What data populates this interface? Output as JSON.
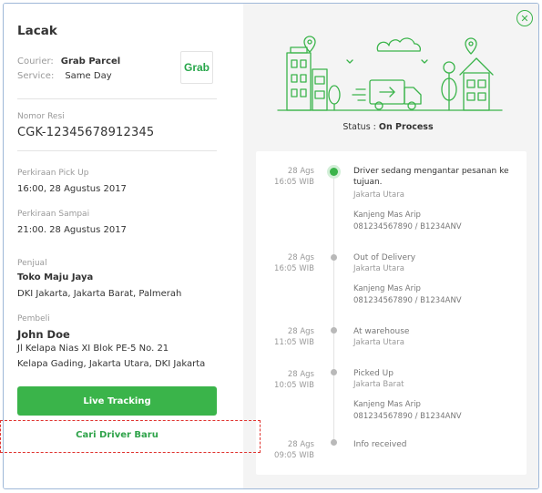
{
  "title": "Lacak",
  "courier": {
    "label": "Courier:",
    "value": "Grab Parcel"
  },
  "service": {
    "label": "Service:",
    "value": "Same Day"
  },
  "logo_text": "Grab",
  "resi": {
    "label": "Nomor Resi",
    "value": "CGK-12345678912345"
  },
  "pickup": {
    "label": "Perkiraan Pick Up",
    "value": "16:00, 28 Agustus 2017"
  },
  "arrival": {
    "label": "Perkiraan Sampai",
    "value": "21:00. 28 Agustus 2017"
  },
  "seller": {
    "label": "Penjual",
    "name": "Toko Maju Jaya",
    "address": "DKI Jakarta, Jakarta Barat, Palmerah"
  },
  "buyer": {
    "label": "Pembeli",
    "name": "John Doe",
    "address1": "Jl Kelapa Nias XI Blok PE-5 No. 21",
    "address2": "Kelapa Gading, Jakarta Utara, DKI Jakarta"
  },
  "buttons": {
    "live_tracking": "Live Tracking",
    "new_driver": "Cari Driver Baru"
  },
  "status": {
    "label": "Status :",
    "value": "On Process"
  },
  "timeline": [
    {
      "date": "28 Ags",
      "time": "16:05 WIB",
      "title": "Driver sedang mengantar pesanan ke tujuan.",
      "location": "Jakarta Utara",
      "driver_name": "Kanjeng Mas Arip",
      "driver_info": "081234567890 / B1234ANV"
    },
    {
      "date": "28 Ags",
      "time": "16:05 WIB",
      "title": "Out of Delivery",
      "location": "Jakarta Utara",
      "driver_name": "Kanjeng Mas Arip",
      "driver_info": "081234567890 / B1234ANV"
    },
    {
      "date": "28 Ags",
      "time": "11:05 WIB",
      "title": "At warehouse",
      "location": "Jakarta Utara"
    },
    {
      "date": "28 Ags",
      "time": "10:05 WIB",
      "title": "Picked  Up",
      "location": "Jakarta Barat",
      "driver_name": "Kanjeng Mas Arip",
      "driver_info": "081234567890 / B1234ANV"
    },
    {
      "date": "28 Ags",
      "time": "09:05 WIB",
      "title": "Info received"
    }
  ],
  "colors": {
    "accent": "#3ab44a",
    "highlight": "#e0332f",
    "panel": "#f4f4f4"
  }
}
